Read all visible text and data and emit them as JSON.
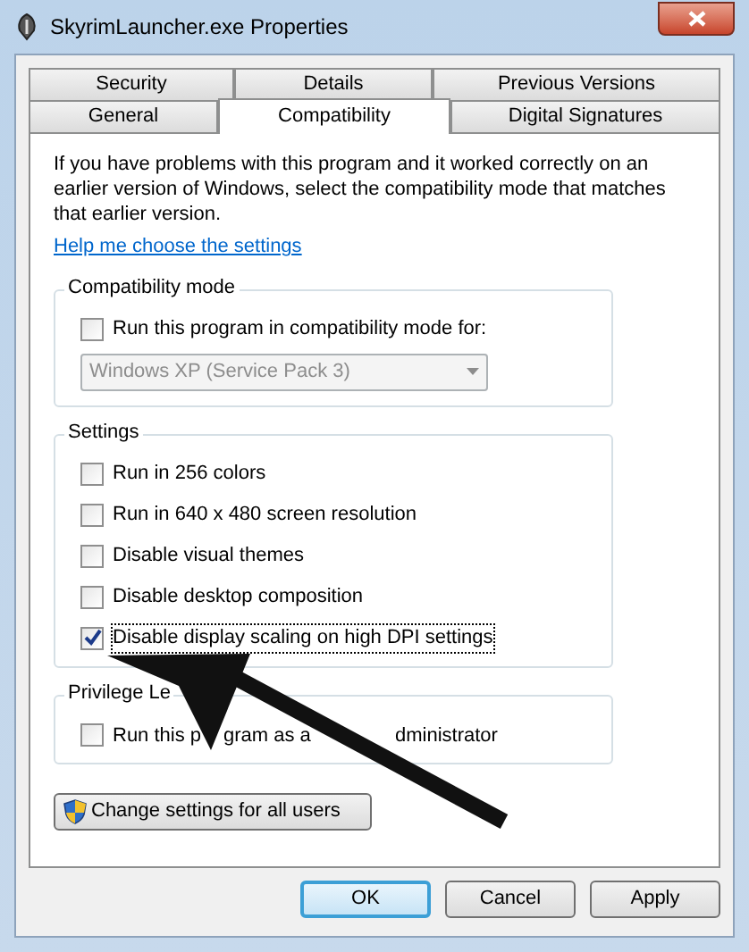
{
  "window": {
    "title": "SkyrimLauncher.exe Properties"
  },
  "tab_rows": [
    [
      {
        "label": "Security",
        "selected": false
      },
      {
        "label": "Details",
        "selected": false
      },
      {
        "label": "Previous Versions",
        "selected": false
      }
    ],
    [
      {
        "label": "General",
        "selected": false
      },
      {
        "label": "Compatibility",
        "selected": true
      },
      {
        "label": "Digital Signatures",
        "selected": false
      }
    ]
  ],
  "intro": "If you have problems with this program and it worked correctly on an earlier version of Windows, select the compatibility mode that matches that earlier version.",
  "help_link": "Help me choose the settings",
  "groups": [
    {
      "title": "Compatibility mode",
      "options": [
        {
          "label": "Run this program in compatibility mode for:",
          "checked": false,
          "focused": false
        }
      ],
      "dropdown": {
        "value": "Windows XP (Service Pack 3)",
        "disabled": true
      }
    },
    {
      "title": "Settings",
      "options": [
        {
          "label": "Run in 256 colors",
          "checked": false,
          "focused": false
        },
        {
          "label": "Run in 640 x 480 screen resolution",
          "checked": false,
          "focused": false
        },
        {
          "label": "Disable visual themes",
          "checked": false,
          "focused": false
        },
        {
          "label": "Disable desktop composition",
          "checked": false,
          "focused": false
        },
        {
          "label": "Disable display scaling on high DPI settings",
          "checked": true,
          "focused": true
        }
      ]
    },
    {
      "title": "Privilege Le",
      "options": [
        {
          "label_parts": [
            "Run this p",
            "gram as a",
            "dministrator"
          ],
          "checked": false,
          "focused": false
        }
      ]
    }
  ],
  "change_all_button": "Change settings for all users",
  "buttons": [
    {
      "label": "OK",
      "default": true
    },
    {
      "label": "Cancel",
      "default": false
    },
    {
      "label": "Apply",
      "default": false
    }
  ]
}
